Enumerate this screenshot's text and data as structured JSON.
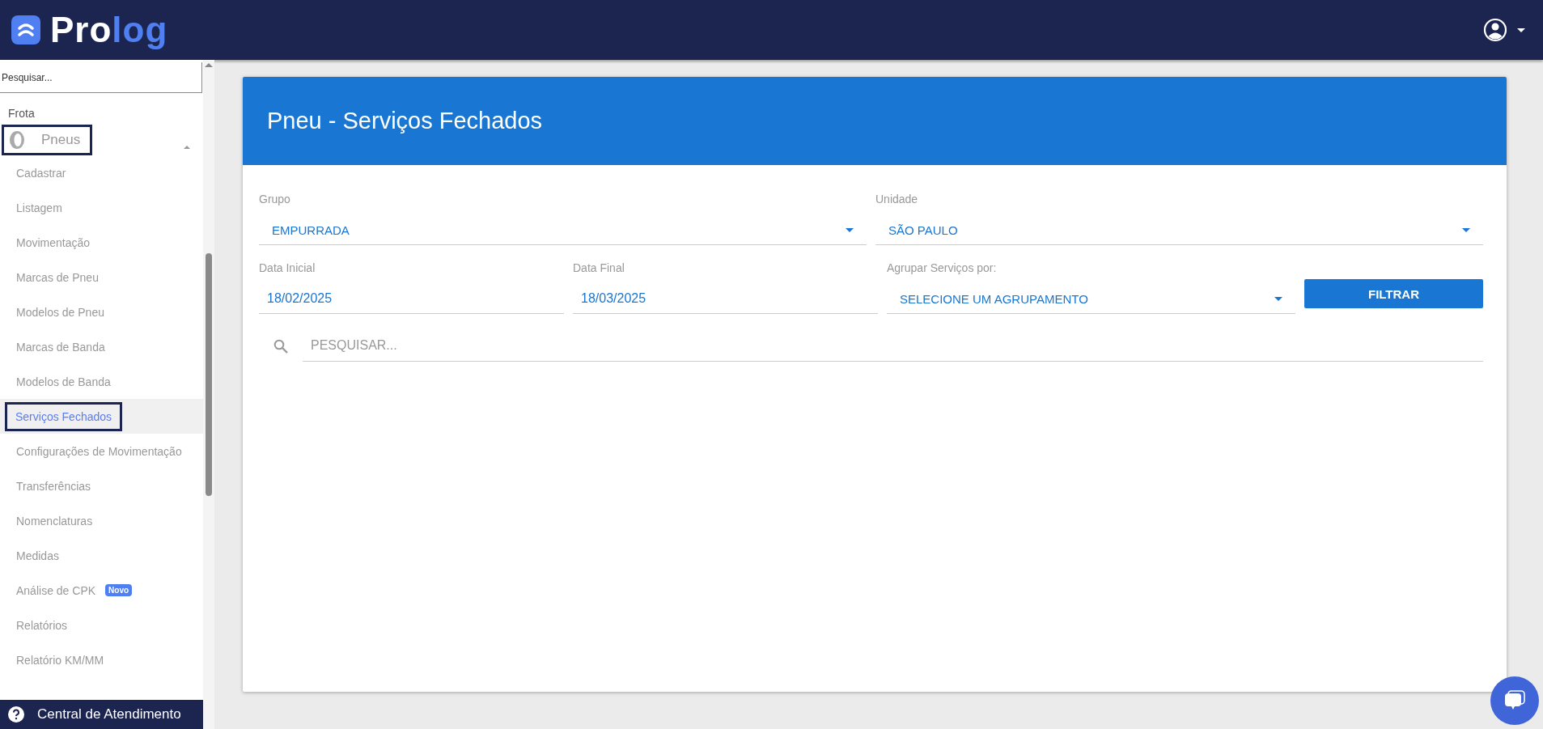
{
  "header": {
    "logo_text": "Pro",
    "logo_accent": "log"
  },
  "sidebar": {
    "search": {
      "placeholder": "Pesquisar..."
    },
    "section": "Frota",
    "group": {
      "label": "Pneus",
      "expanded": true,
      "children": [
        {
          "label": "Cadastrar",
          "selected": false
        },
        {
          "label": "Listagem",
          "selected": false
        },
        {
          "label": "Movimentação",
          "selected": false
        },
        {
          "label": "Marcas de Pneu",
          "selected": false
        },
        {
          "label": "Modelos de Pneu",
          "selected": false
        },
        {
          "label": "Marcas de Banda",
          "selected": false
        },
        {
          "label": "Modelos de Banda",
          "selected": false
        },
        {
          "label": "Serviços Fechados",
          "selected": true
        },
        {
          "label": "Configurações de Movimentação",
          "selected": false
        },
        {
          "label": "Transferências",
          "selected": false
        },
        {
          "label": "Nomenclaturas",
          "selected": false
        },
        {
          "label": "Medidas",
          "selected": false
        },
        {
          "label": "Análise de CPK",
          "selected": false,
          "badge": "Novo"
        },
        {
          "label": "Relatórios",
          "selected": false
        },
        {
          "label": "Relatório KM/MM",
          "selected": false
        }
      ]
    },
    "help": "Central de Atendimento"
  },
  "card": {
    "title": "Pneu - Serviços Fechados",
    "grupo": {
      "label": "Grupo",
      "value": "EMPURRADA"
    },
    "unidade": {
      "label": "Unidade",
      "value": "SÃO PAULO"
    },
    "data_inicial": {
      "label": "Data Inicial",
      "value": "18/02/2025"
    },
    "data_final": {
      "label": "Data Final",
      "value": "18/03/2025"
    },
    "agrupar": {
      "label": "Agrupar Serviços por:",
      "value": "SELECIONE UM AGRUPAMENTO"
    },
    "button": "FILTRAR",
    "search": {
      "placeholder": "PESQUISAR..."
    }
  }
}
